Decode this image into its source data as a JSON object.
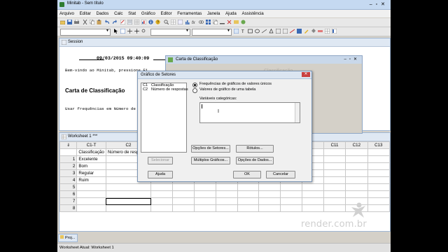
{
  "app": {
    "title": "Minitab - Sem título"
  },
  "menu": [
    "Arquivo",
    "Editar",
    "Dados",
    "Calc",
    "Stat",
    "Gráfico",
    "Editor",
    "Ferramentas",
    "Janela",
    "Ajuda",
    "Assistência"
  ],
  "session": {
    "title": "Session",
    "timestamp": "09/03/2015 09:40:09",
    "welcome": "Bem-vindo ao Minitab, pressione F1",
    "heading": "Carta de Classificação",
    "body": "Usar frequências em Número de res"
  },
  "carta_dialog": {
    "title": "Carta de Classificação",
    "watermark": "Classificação"
  },
  "dialog": {
    "title": "Gráfico de Setores",
    "variables": [
      {
        "col": "C1",
        "name": "Classificação"
      },
      {
        "col": "C2",
        "name": "Número de respostas"
      }
    ],
    "option_unique": "Frequências de gráficos de valores únicos",
    "option_table": "Valores de gráfico de uma tabela",
    "categ_label": "Variáveis categóricas:",
    "btn_select": "Selecionar",
    "btn_help": "Ajuda",
    "btn_sector_options": "Opções de Setores...",
    "btn_labels": "Rótulos...",
    "btn_multiple": "Múltiplos Gráficos...",
    "btn_data_options": "Opções de Dados...",
    "btn_ok": "OK",
    "btn_cancel": "Cancelar"
  },
  "worksheet": {
    "title": "Worksheet 1 ***",
    "col_c1": "C1-T",
    "col_c2": "C2",
    "right_cols": [
      "C11",
      "C12",
      "C13"
    ],
    "col_names": [
      "Classificação",
      "Número de resp"
    ],
    "row_nums": [
      "1",
      "2",
      "3",
      "4",
      "5",
      "6",
      "7",
      "8"
    ],
    "c1_values": [
      "Excelente",
      "Bom",
      "Regular",
      "Ruim",
      "",
      "",
      "",
      ""
    ]
  },
  "taskbar": {
    "proj": "Proj..."
  },
  "statusbar": {
    "text": "Worksheet Atual: Worksheet 1"
  },
  "watermark": {
    "brand": "render",
    "suffix": ".com.br"
  }
}
